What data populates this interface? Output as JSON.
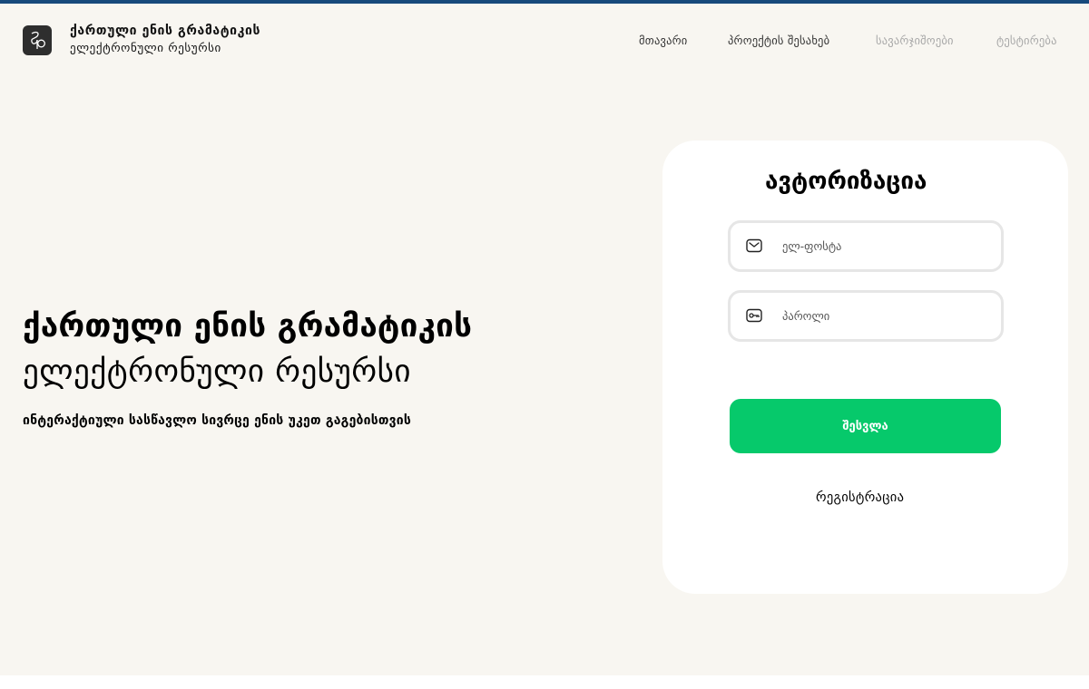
{
  "header": {
    "brand_line1": "ქართული ენის გრამატიკის",
    "brand_line2": "ელექტრონული რესურსი",
    "nav": [
      {
        "label": "მთავარი",
        "active": true
      },
      {
        "label": "პროექტის შესახებ",
        "active": true
      },
      {
        "label": "სავარჯიშოები",
        "active": false
      },
      {
        "label": "ტესტირება",
        "active": false
      }
    ]
  },
  "hero": {
    "title": "ქართული ენის გრამატიკის",
    "subtitle": "ელექტრონული რესურსი",
    "description": "ინტერაქტიული სასწავლო სივრცე ენის უკეთ გაგებისთვის"
  },
  "login": {
    "title": "ავტორიზაცია",
    "email_placeholder": "ელ-ფოსტა",
    "email_value": "",
    "password_placeholder": "პაროლი",
    "password_value": "",
    "submit_label": "შესვლა",
    "register_label": "რეგისტრაცია",
    "email_icon": "envelope-icon",
    "password_icon": "key-icon"
  },
  "colors": {
    "background": "#f8f6f1",
    "topline": "#174a7c",
    "accent": "#06c96b",
    "nav_inactive": "#a8a8a8"
  }
}
